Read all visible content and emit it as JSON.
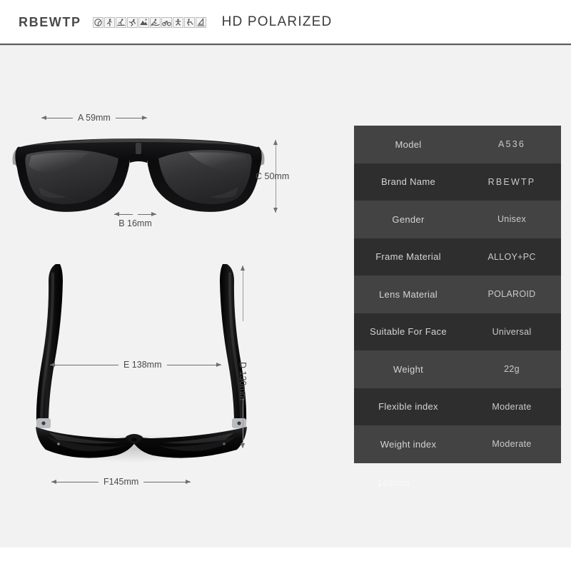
{
  "header": {
    "brand": "RBEWTP",
    "tagline": "HD POLARIZED",
    "sport_icons": [
      "fishing-icon",
      "running-icon",
      "skiing-icon",
      "climbing-icon",
      "hiking-icon",
      "surfing-icon",
      "cycling-icon",
      "skating-icon",
      "golf-icon",
      "sailing-icon"
    ]
  },
  "dimensions": {
    "lens_width": "A 59mm",
    "bridge": "B 16mm",
    "lens_height": "C 50mm",
    "temple_length": "D 130mm",
    "frame_inner_width": "E 138mm",
    "frame_total_width": "F145mm"
  },
  "spec_table": {
    "rows": [
      {
        "key": "Model",
        "value": "A536",
        "wide": true
      },
      {
        "key": "Brand Name",
        "value": "RBEWTP",
        "wide": true
      },
      {
        "key": "Gender",
        "value": "Unisex",
        "wide": false
      },
      {
        "key": "Frame Material",
        "value": "ALLOY+PC",
        "wide": false
      },
      {
        "key": "Lens Material",
        "value": "POLAROID",
        "wide": false
      },
      {
        "key": "Suitable For Face",
        "value": "Universal",
        "wide": false
      },
      {
        "key": "Weight",
        "value": "22g",
        "wide": false
      },
      {
        "key": "Flexible index",
        "value": "Moderate",
        "wide": false
      },
      {
        "key": "Weight index",
        "value": "Moderate",
        "wide": false
      }
    ]
  },
  "watermark": "148mm",
  "colors": {
    "page_bg": "#f2f2f2",
    "header_bg": "#ffffff",
    "row_light": "#434343",
    "row_dark": "#2e2e2e",
    "text_dark": "#4a4a4a",
    "rule": "#5a5a5a"
  }
}
